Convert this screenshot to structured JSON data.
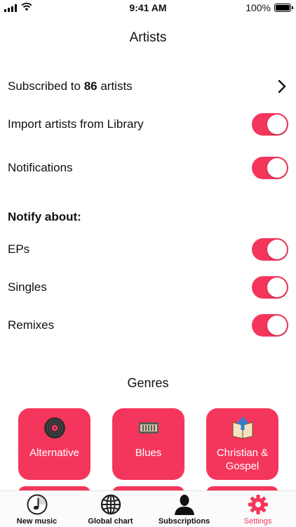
{
  "status_bar": {
    "time": "9:41 AM",
    "battery": "100%"
  },
  "header": {
    "title": "Artists"
  },
  "subscribed": {
    "prefix": "Subscribed to ",
    "count": "86",
    "suffix": " artists"
  },
  "settings": {
    "import_label": "Import artists from Library",
    "import_on": true,
    "notifications_label": "Notifications",
    "notifications_on": true
  },
  "notify": {
    "heading": "Notify about:",
    "items": [
      {
        "label": "EPs",
        "on": true
      },
      {
        "label": "Singles",
        "on": true
      },
      {
        "label": "Remixes",
        "on": true
      }
    ]
  },
  "genres": {
    "title": "Genres",
    "items": [
      {
        "label": "Alternative",
        "icon": "vinyl-record-icon"
      },
      {
        "label": "Blues",
        "icon": "harmonica-icon"
      },
      {
        "label": "Christian & Gospel",
        "icon": "bible-cross-icon"
      }
    ]
  },
  "colors": {
    "accent": "#f5365c",
    "tile_icon": "#3a3a3a"
  },
  "tabs": [
    {
      "label": "New music",
      "icon": "music-note-icon",
      "active": false
    },
    {
      "label": "Global chart",
      "icon": "globe-icon",
      "active": false
    },
    {
      "label": "Subscriptions",
      "icon": "person-icon",
      "active": false
    },
    {
      "label": "Settings",
      "icon": "gear-icon",
      "active": true
    }
  ]
}
